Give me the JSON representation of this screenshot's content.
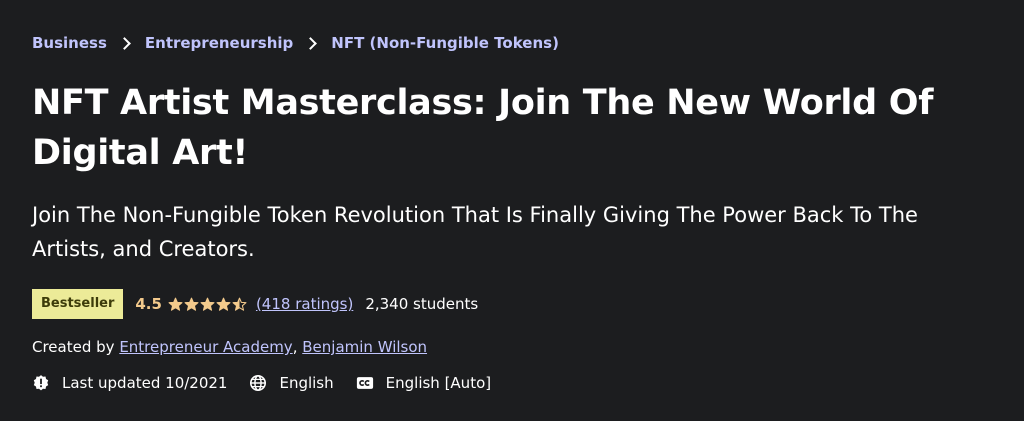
{
  "breadcrumb": {
    "items": [
      "Business",
      "Entrepreneurship",
      "NFT (Non-Fungible Tokens)"
    ]
  },
  "course": {
    "title": "NFT Artist Masterclass: Join The New World Of Digital Art!",
    "subtitle": "Join The Non-Fungible Token Revolution That Is Finally Giving The Power Back To The Artists, and Creators."
  },
  "rating": {
    "badge": "Bestseller",
    "value": "4.5",
    "stars": 4.5,
    "ratings_count": "(418 ratings)",
    "students": "2,340 students"
  },
  "creators": {
    "prefix": "Created by",
    "names": [
      "Entrepreneur Academy",
      "Benjamin Wilson"
    ],
    "separator": ","
  },
  "meta": {
    "last_updated": "Last updated 10/2021",
    "language": "English",
    "captions": "English [Auto]"
  },
  "icons": {
    "breadcrumb_separator": "chevron-right-icon",
    "updated": "alert-badge-icon",
    "language": "globe-icon",
    "captions": "closed-captions-icon"
  },
  "colors": {
    "background": "#1c1d1f",
    "link": "#c0c4fc",
    "rating": "#f3ca8c",
    "badge_bg": "#eceb98",
    "badge_text": "#3d3c0a"
  }
}
